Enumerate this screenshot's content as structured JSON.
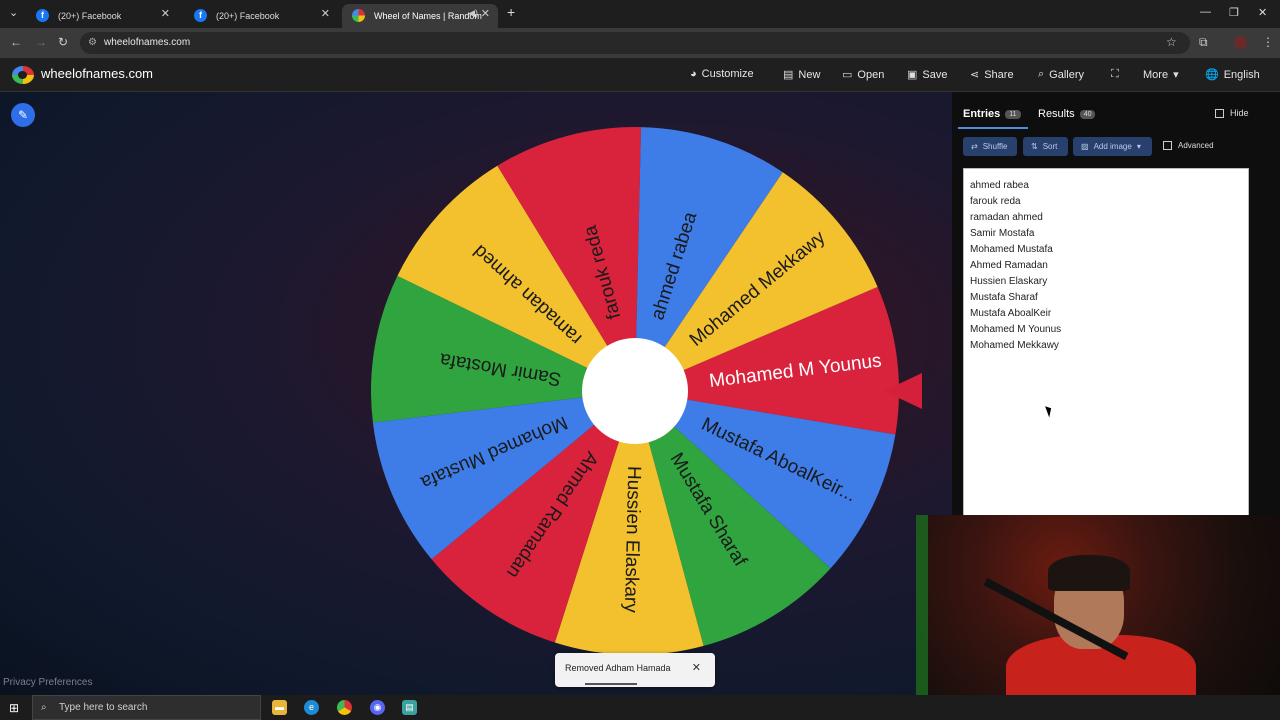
{
  "browser": {
    "tabs": [
      {
        "title": "(20+) Facebook",
        "favicon": "f",
        "active": false
      },
      {
        "title": "(20+) Facebook",
        "favicon": "f",
        "active": false
      },
      {
        "title": "Wheel of Names | Random",
        "favicon": "",
        "active": true
      }
    ],
    "url": "wheelofnames.com"
  },
  "site": {
    "title": "wheelofnames.com",
    "menu": [
      "Customize",
      "New",
      "Open",
      "Save",
      "Share",
      "Gallery",
      "",
      "More",
      "English"
    ]
  },
  "panel": {
    "entries_label": "Entries",
    "entries_count": "11",
    "results_label": "Results",
    "results_count": "40",
    "hide_label": "Hide",
    "shuffle_label": "Shuffle",
    "sort_label": "Sort",
    "add_image_label": "Add image",
    "advanced_label": "Advanced",
    "entries": [
      "ahmed rabea",
      "farouk reda",
      "ramadan ahmed",
      "Samir Mostafa",
      "Mohamed Mustafa",
      "Ahmed Ramadan",
      "Hussien Elaskary",
      "Mustafa Sharaf",
      "Mustafa AboalKeir",
      "Mohamed M Younus",
      "Mohamed Mekkawy"
    ]
  },
  "wheel": {
    "segments": [
      {
        "label": "Mohamed M Younus",
        "color": "#d9233d"
      },
      {
        "label": "Mustafa AboalKeir...",
        "color": "#3e7de8"
      },
      {
        "label": "Mustafa Sharaf",
        "color": "#2fa43f"
      },
      {
        "label": "Hussien Elaskary",
        "color": "#f3c12e"
      },
      {
        "label": "Ahmed Ramadan",
        "color": "#d9233d"
      },
      {
        "label": "Mohamed Mustafa",
        "color": "#3e7de8"
      },
      {
        "label": "Samir Mostafa",
        "color": "#2fa43f"
      },
      {
        "label": "ramadan ahmed",
        "color": "#f3c12e"
      },
      {
        "label": "farouk reda",
        "color": "#d9233d"
      },
      {
        "label": "ahmed rabea",
        "color": "#3e7de8"
      },
      {
        "label": "Mohamed Mekkawy",
        "color": "#f3c12e"
      }
    ]
  },
  "toast": {
    "text": "Removed Adham Hamada"
  },
  "footer": {
    "privacy": "Privacy Preferences"
  },
  "taskbar": {
    "search_placeholder": "Type here to search"
  }
}
